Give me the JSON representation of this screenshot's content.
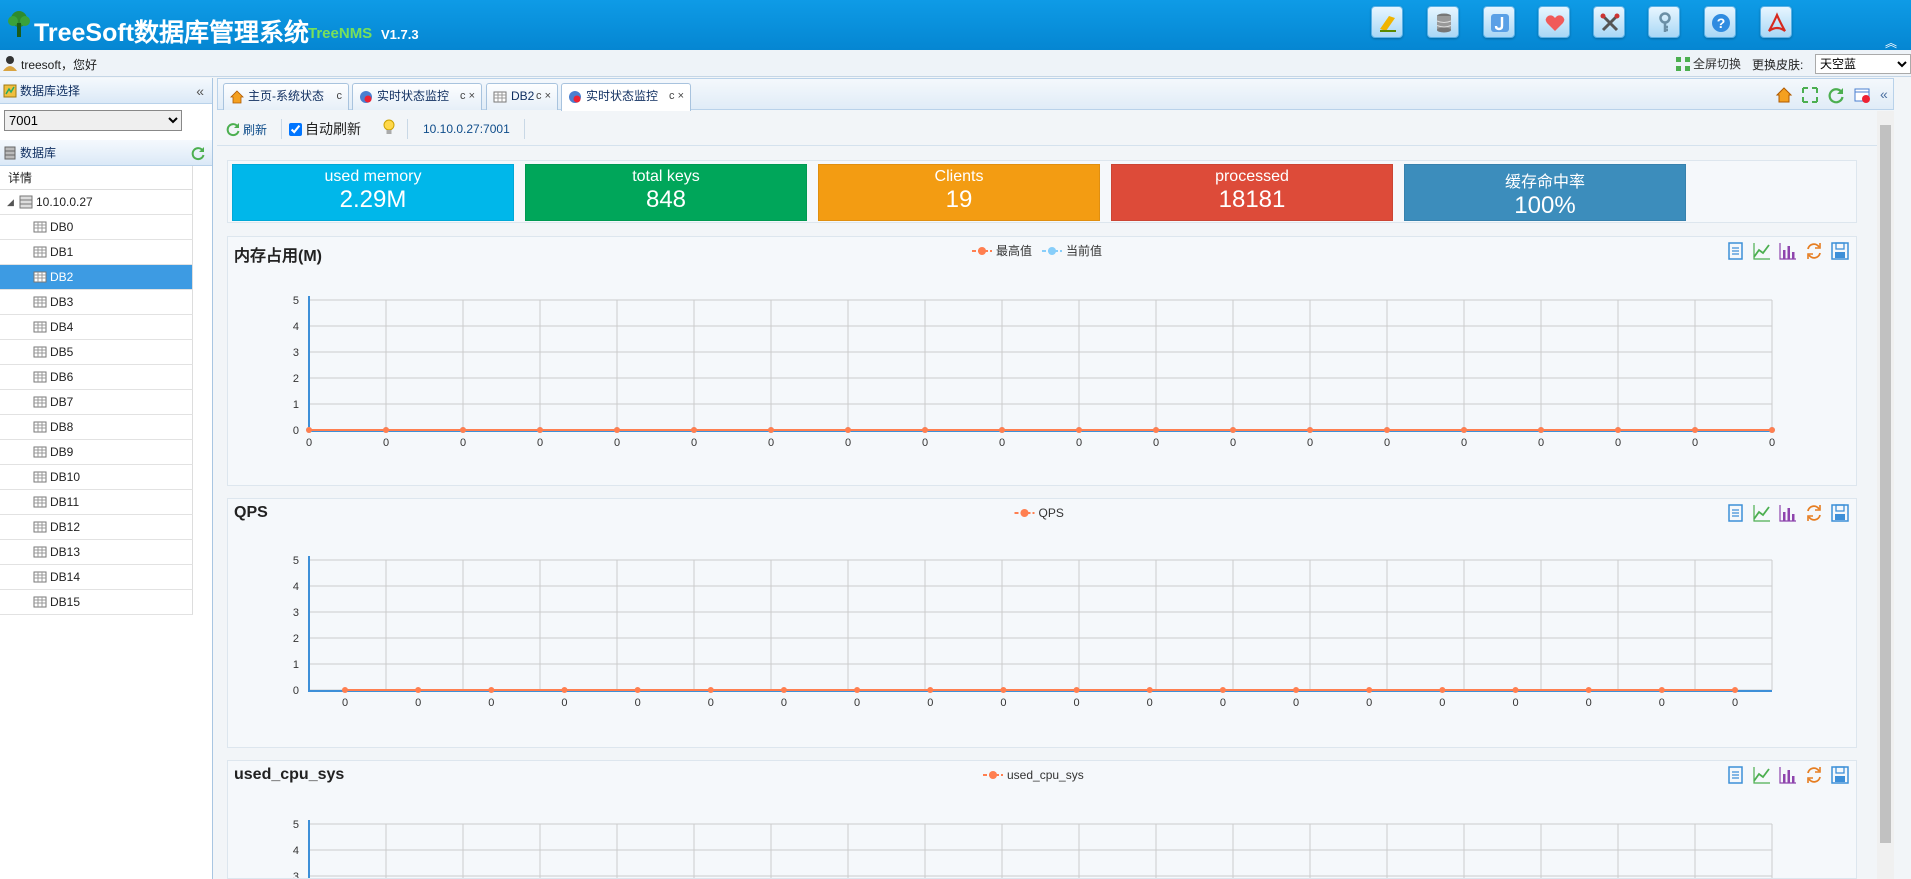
{
  "header": {
    "title": "TreeSoft数据库管理系统",
    "subtitle": "TreeNMS",
    "version": "V1.7.3",
    "toolbar_icons": [
      "sql-icon",
      "database-icon",
      "j-icon",
      "heart-icon",
      "tools-icon",
      "key-icon",
      "help-icon",
      "acrobat-icon"
    ]
  },
  "userbar": {
    "user": "treesoft，您好",
    "fullscreen": "全屏切换",
    "skin_label": "更换皮肤:",
    "skin_value": "天空蓝"
  },
  "sidebar": {
    "select_title": "数据库选择",
    "select_value": "7001",
    "db_title": "数据库",
    "tree_header": "详情",
    "host": "10.10.0.27",
    "dbs": [
      "DB0",
      "DB1",
      "DB2",
      "DB3",
      "DB4",
      "DB5",
      "DB6",
      "DB7",
      "DB8",
      "DB9",
      "DB10",
      "DB11",
      "DB12",
      "DB13",
      "DB14",
      "DB15"
    ],
    "selected": "DB2"
  },
  "tabs": [
    {
      "label": "主页-系统状态",
      "close": "c"
    },
    {
      "label": "实时状态监控",
      "close": "c ×"
    },
    {
      "label": "DB2",
      "close": "c ×"
    },
    {
      "label": "实时状态监控",
      "close": "c ×"
    }
  ],
  "toolbar": {
    "refresh": "刷新",
    "auto_refresh": "自动刷新",
    "host_port": "10.10.0.27:7001"
  },
  "stats": [
    {
      "label": "used memory",
      "value": "2.29M",
      "color": "#00b7ea"
    },
    {
      "label": "total keys",
      "value": "848",
      "color": "#00a65a"
    },
    {
      "label": "Clients",
      "value": "19",
      "color": "#f39c12"
    },
    {
      "label": "processed",
      "value": "18181",
      "color": "#dd4b39"
    },
    {
      "label": "缓存命中率",
      "value": "100%",
      "color": "#3c8dbc"
    }
  ],
  "charts": [
    {
      "title": "内存占用(M)",
      "legend": [
        "最高值",
        "当前值"
      ]
    },
    {
      "title": "QPS",
      "legend": [
        "QPS"
      ]
    },
    {
      "title": "used_cpu_sys",
      "legend": [
        "used_cpu_sys"
      ]
    }
  ],
  "chart_data": [
    {
      "type": "line",
      "title": "内存占用(M)",
      "categories": [
        "0",
        "0",
        "0",
        "0",
        "0",
        "0",
        "0",
        "0",
        "0",
        "0",
        "0",
        "0",
        "0",
        "0",
        "0",
        "0",
        "0",
        "0",
        "0",
        "0"
      ],
      "series": [
        {
          "name": "最高值",
          "color": "#ff7f50",
          "values": [
            0,
            0,
            0,
            0,
            0,
            0,
            0,
            0,
            0,
            0,
            0,
            0,
            0,
            0,
            0,
            0,
            0,
            0,
            0,
            0
          ]
        },
        {
          "name": "当前值",
          "color": "#87cefa",
          "values": [
            0,
            0,
            0,
            0,
            0,
            0,
            0,
            0,
            0,
            0,
            0,
            0,
            0,
            0,
            0,
            0,
            0,
            0,
            0,
            0
          ]
        }
      ],
      "ylim": [
        0,
        5
      ],
      "yticks": [
        "0",
        "1",
        "2",
        "3",
        "4",
        "5"
      ],
      "legend": "top-center",
      "grid": true
    },
    {
      "type": "line",
      "title": "QPS",
      "categories": [
        "0",
        "0",
        "0",
        "0",
        "0",
        "0",
        "0",
        "0",
        "0",
        "0",
        "0",
        "0",
        "0",
        "0",
        "0",
        "0",
        "0",
        "0",
        "0",
        "0"
      ],
      "series": [
        {
          "name": "QPS",
          "color": "#ff7f50",
          "values": [
            0,
            0,
            0,
            0,
            0,
            0,
            0,
            0,
            0,
            0,
            0,
            0,
            0,
            0,
            0,
            0,
            0,
            0,
            0,
            0
          ]
        }
      ],
      "ylim": [
        0,
        5
      ],
      "yticks": [
        "0",
        "1",
        "2",
        "3",
        "4",
        "5"
      ],
      "legend": "top-center",
      "grid": true
    },
    {
      "type": "line",
      "title": "used_cpu_sys",
      "categories": [],
      "series": [
        {
          "name": "used_cpu_sys",
          "color": "#ff7f50",
          "values": []
        }
      ],
      "ylim": [
        0,
        5
      ],
      "yticks": [
        "3",
        "4",
        "5"
      ],
      "legend": "top-center",
      "grid": true
    }
  ]
}
